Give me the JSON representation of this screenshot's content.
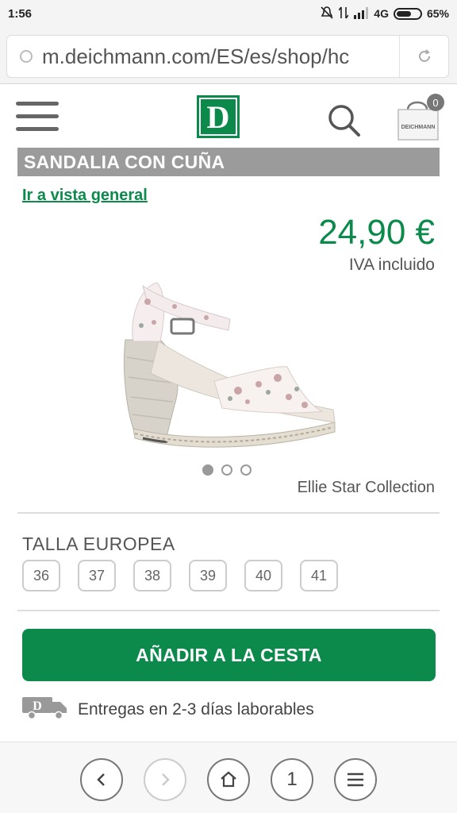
{
  "status": {
    "time": "1:56",
    "network": "4G",
    "battery": "65%",
    "battery_level": 0.65
  },
  "browser": {
    "url": "m.deichmann.com/ES/es/shop/hc"
  },
  "header": {
    "logo_letter": "D",
    "cart_count": "0",
    "cart_label": "DEICHMANN"
  },
  "product": {
    "title": "SANDALIA CON CUÑA",
    "back_link": "Ir a vista general",
    "price": "24,90 €",
    "tax_note": "IVA incluido",
    "brand": "Ellie Star Collection",
    "image_count": 3,
    "active_image": 1
  },
  "sizes": {
    "label": "TALLA EUROPEA",
    "options": [
      "36",
      "37",
      "38",
      "39",
      "40",
      "41"
    ]
  },
  "cart_button": {
    "label": "AÑADIR A LA CESTA"
  },
  "delivery": {
    "text": "Entregas en 2-3 días laborables",
    "truck_letter": "D"
  },
  "nav": {
    "tabs_count": "1"
  },
  "colors": {
    "brand_green": "#0c8a4c",
    "title_bar": "#9b9b9b"
  }
}
